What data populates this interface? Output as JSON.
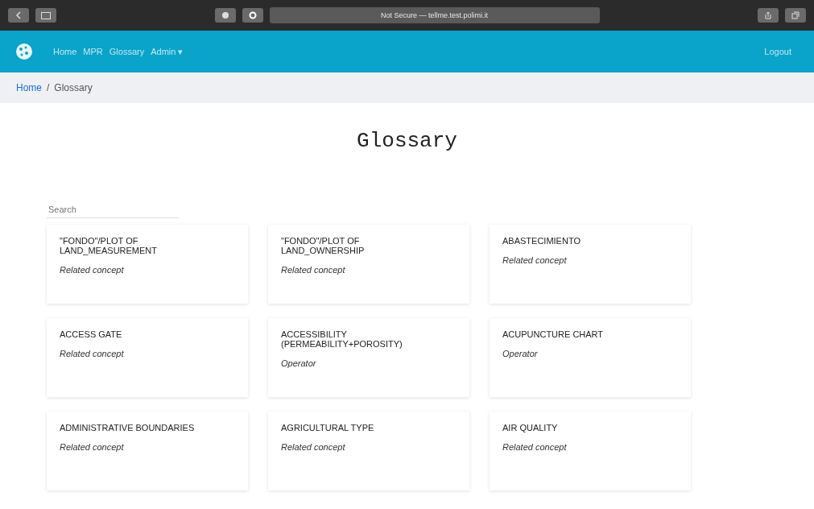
{
  "browser": {
    "address": "Not Secure — tellme.test.polimi.it"
  },
  "nav": {
    "links": [
      {
        "label": "Home"
      },
      {
        "label": "MPR"
      },
      {
        "label": "Glossary"
      },
      {
        "label": "Admin ▾"
      }
    ],
    "logout": "Logout"
  },
  "breadcrumb_separator": "/",
  "breadcrumb": [
    {
      "label": "Home",
      "kind": "link"
    },
    {
      "label": "Glossary",
      "kind": "current"
    }
  ],
  "title": "Glossary",
  "search": {
    "placeholder": "Search"
  },
  "cards": [
    {
      "term": "\"FONDO\"/PLOT OF LAND_MEASUREMENT",
      "type": "Related concept"
    },
    {
      "term": "\"FONDO\"/PLOT OF LAND_OWNERSHIP",
      "type": "Related concept"
    },
    {
      "term": "ABASTECIMIENTO",
      "type": "Related concept"
    },
    {
      "term": "ACCESS GATE",
      "type": "Related concept"
    },
    {
      "term": "ACCESSIBILITY (PERMEABILITY+POROSITY)",
      "type": "Operator"
    },
    {
      "term": "ACUPUNCTURE CHART",
      "type": "Operator"
    },
    {
      "term": "ADMINISTRATIVE BOUNDARIES",
      "type": "Related concept"
    },
    {
      "term": "AGRICULTURAL TYPE",
      "type": "Related concept"
    },
    {
      "term": "AIR QUALITY",
      "type": "Related concept"
    }
  ]
}
